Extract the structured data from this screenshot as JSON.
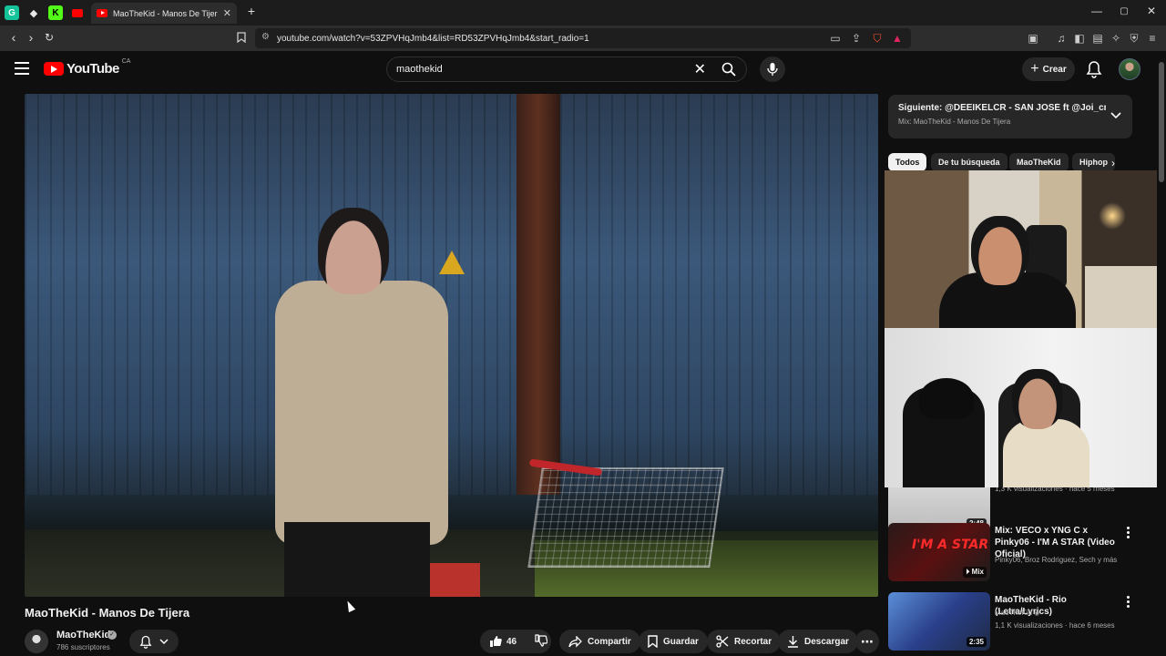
{
  "browser": {
    "tab_title": "MaoTheKid - Manos De Tijera - YouTube",
    "tab_close": "✕",
    "new_tab": "+",
    "url": "youtube.com/watch?v=53ZPVHqJmb4&list=RD53ZPVHqJmb4&start_radio=1",
    "window_controls": [
      "—",
      "▢",
      "✕"
    ],
    "pinned_tabs": [
      {
        "icon": "grammarly-icon",
        "color": "#15c39a",
        "glyph": "G"
      },
      {
        "icon": "diamond-icon",
        "color": "#e8e8e8",
        "glyph": "◆"
      },
      {
        "icon": "kick-icon",
        "color": "#53fc18",
        "glyph": "K"
      },
      {
        "icon": "youtube-icon",
        "color": "#ff0000",
        "glyph": "▶"
      }
    ]
  },
  "header": {
    "logo_text": "YouTube",
    "country_code": "CA",
    "search_value": "maothekid",
    "create_label": "Crear"
  },
  "video": {
    "title": "MaoTheKid - Manos De Tijera",
    "channel": "MaoTheKid",
    "subscribers": "786 suscriptores",
    "likes": "46",
    "share_label": "Compartir",
    "save_label": "Guardar",
    "clip_label": "Recortar",
    "download_label": "Descargar"
  },
  "sidebar": {
    "up_next_title": "Siguiente: @DEEIKELCR - SAN JOSÉ ft @Joi_cr (Vis...",
    "up_next_subtitle": "Mix: MaoTheKid - Manos De Tijera",
    "chips": [
      "Todos",
      "De tu búsqueda",
      "MaoTheKid",
      "Hiphop"
    ],
    "recommendations": [
      {
        "title": "",
        "channel": "",
        "meta": "1,3 K visualizaciones · hace 5 meses",
        "duration": "2:48"
      },
      {
        "title": "Mix: VECO x YNG C x Pinky06 - I'M A STAR (Video Oficial)",
        "channel": "Pinky06, Broz Rodriguez, Sech y más",
        "meta": "",
        "duration": "Mix",
        "thumb_text": "I'M A STAR"
      },
      {
        "title": "MaoTheKid - Rio (Letra/Lyrics)",
        "channel": "MaoTheKid",
        "meta": "1,1 K visualizaciones · hace 6 meses",
        "duration": "2:35"
      }
    ]
  },
  "colors": {
    "background": "#0f0f0f",
    "brand_red": "#ff0000",
    "chip_active": "#f1f1f1",
    "pill_bg": "#272727"
  }
}
